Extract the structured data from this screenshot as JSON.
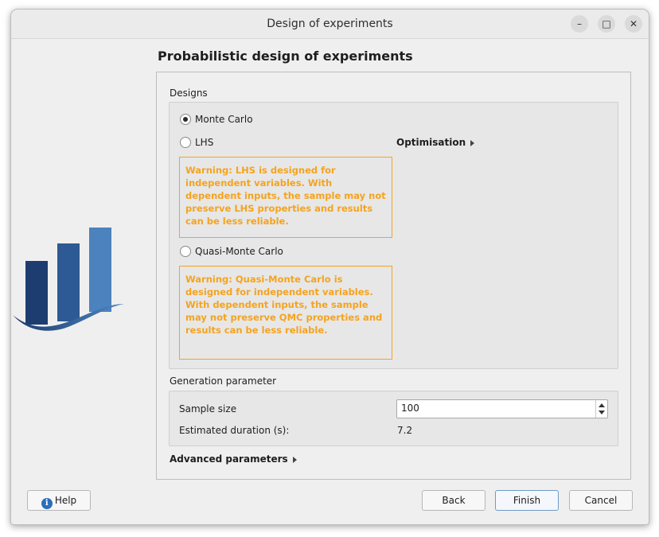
{
  "window": {
    "title": "Design of experiments",
    "controls": [
      "minimize-icon",
      "maximize-icon",
      "close-icon"
    ]
  },
  "page": {
    "heading": "Probabilistic design of experiments"
  },
  "designs": {
    "label": "Designs",
    "options": [
      {
        "label": "Monte Carlo",
        "checked": true
      },
      {
        "label": "LHS",
        "checked": false
      },
      {
        "label": "Quasi-Monte Carlo",
        "checked": false
      }
    ],
    "lhs_warning": "Warning: LHS is designed for independent variables. With dependent inputs, the sample may not preserve LHS properties and results can be less reliable.",
    "qmc_warning": "Warning: Quasi-Monte Carlo is designed for independent variables. With dependent inputs, the sample may not preserve QMC properties and results can be less reliable.",
    "optimisation_label": "Optimisation"
  },
  "generation": {
    "label": "Generation parameter",
    "sample_size_label": "Sample size",
    "sample_size_value": "100",
    "duration_label": "Estimated duration (s):",
    "duration_value": "7.2"
  },
  "advanced": {
    "label": "Advanced parameters"
  },
  "buttons": {
    "help": "Help",
    "back": "Back",
    "finish": "Finish",
    "cancel": "Cancel"
  },
  "colors": {
    "warning": "#f5a31e",
    "logo_dark": "#1b3a6b",
    "logo_light": "#4f86c1"
  }
}
